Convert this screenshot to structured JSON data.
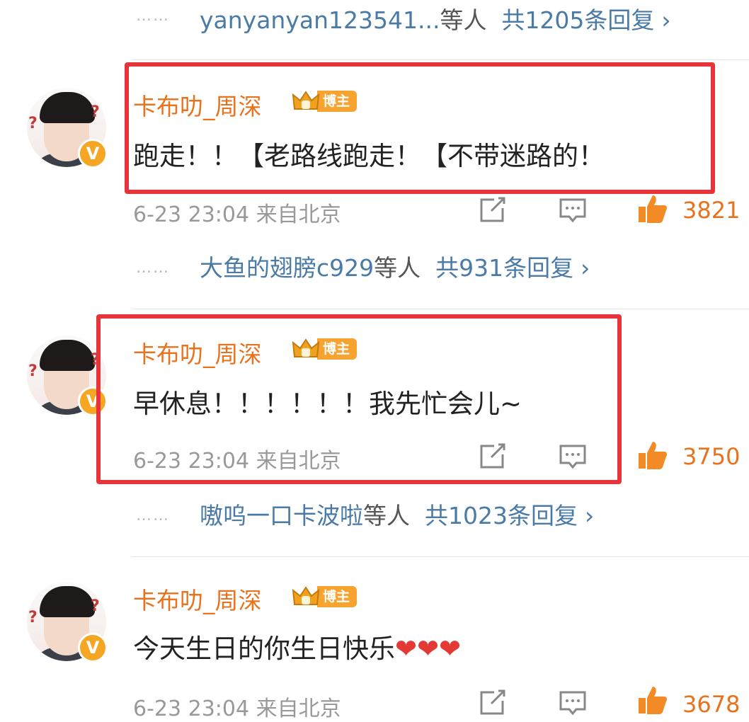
{
  "colors": {
    "username": "#e8731f",
    "link": "#4a7aa6",
    "meta": "#999999",
    "highlight_box": "#e6343a",
    "badge": "#f7a330"
  },
  "top_reply_summary": {
    "dots": "……",
    "who": "yanyanyan123541...",
    "mid": "等人",
    "count": "共1205条回复",
    "chevron": "›"
  },
  "comments": [
    {
      "username": "卡布叻_周深",
      "badge": "博主",
      "text": "跑走！！【老路线跑走！【不带迷路的！",
      "time": "6-23 23:04",
      "source": "来自北京",
      "likes": "3821",
      "reply_summary": {
        "dots": "……",
        "who": "大鱼的翅膀c929",
        "mid": "等人",
        "count": "共931条回复",
        "chevron": "›"
      }
    },
    {
      "username": "卡布叻_周深",
      "badge": "博主",
      "text": "早休息！！！！！！我先忙会儿~",
      "time": "6-23 23:04",
      "source": "来自北京",
      "likes": "3750",
      "reply_summary": {
        "dots": "……",
        "who": "嗷呜一口卡波啦",
        "mid": "等人",
        "count": "共1023条回复",
        "chevron": "›"
      }
    },
    {
      "username": "卡布叻_周深",
      "badge": "博主",
      "text": "今天生日的你生日快乐",
      "hearts": "❤❤❤",
      "time": "6-23 23:04",
      "source": "来自北京",
      "likes": "3678"
    }
  ],
  "icons": {
    "verified": "V",
    "share": "share-icon",
    "comment": "comment-icon",
    "like": "thumbs-up-icon",
    "crown": "crown-icon"
  }
}
